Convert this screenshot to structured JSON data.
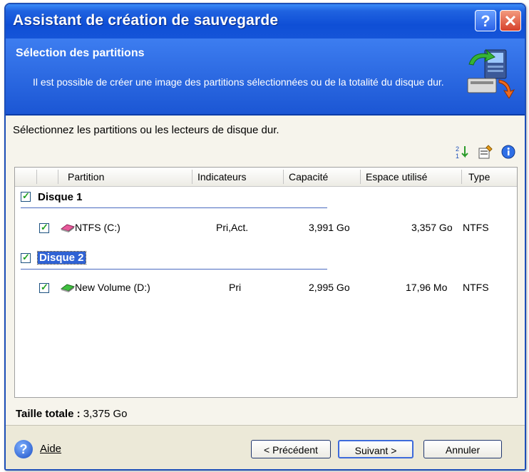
{
  "window": {
    "title": "Assistant de création de sauvegarde",
    "help_glyph": "?",
    "close_glyph": "✕"
  },
  "header": {
    "title": "Sélection des partitions",
    "description": "Il est possible de créer une image des partitions sélectionnées ou de la totalité du disque dur."
  },
  "instruction": "Sélectionnez les partitions ou les lecteurs de disque dur.",
  "toolbar_icons": [
    "sort-icon",
    "properties-icon",
    "info-icon"
  ],
  "table": {
    "columns": [
      "Partition",
      "Indicateurs",
      "Capacité",
      "Espace utilisé",
      "Type"
    ],
    "groups": [
      {
        "label": "Disque 1",
        "checked": true,
        "rows": [
          {
            "partition": "NTFS (C:)",
            "flags": "Pri,Act.",
            "capacity": "3,991 Go",
            "used": "3,357 Go",
            "type": "NTFS",
            "checked": true
          }
        ]
      },
      {
        "label": "Disque 2",
        "checked": true,
        "selected": true,
        "rows": [
          {
            "partition": "New Volume (D:)",
            "flags": "Pri",
            "capacity": "2,995 Go",
            "used": "17,96 Mo",
            "type": "NTFS",
            "checked": true
          }
        ]
      }
    ]
  },
  "total": {
    "label": "Taille totale :",
    "value": "3,375 Go"
  },
  "footer": {
    "help_label": "Aide",
    "help_glyph": "?",
    "back_label": "< Précédent",
    "next_label": "Suivant >",
    "cancel_label": "Annuler"
  },
  "colors": {
    "title_blue": "#1554d8",
    "header_blue": "#2c68e4",
    "check_green": "#21a121"
  }
}
